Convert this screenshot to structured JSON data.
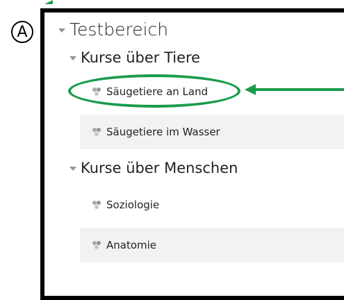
{
  "marker": {
    "label": "A"
  },
  "category": {
    "title": "Testbereich",
    "subcategories": [
      {
        "title": "Kurse über Tiere",
        "courses": [
          {
            "name": "Säugetiere an Land"
          },
          {
            "name": "Säugetiere im Wasser"
          }
        ]
      },
      {
        "title": "Kurse über Menschen",
        "courses": [
          {
            "name": "Soziologie"
          },
          {
            "name": "Anatomie"
          }
        ]
      }
    ]
  },
  "colors": {
    "accent": "#1a9b4b",
    "frame": "#000000",
    "row_alt": "#f2f2f2"
  },
  "icons": {
    "collapse": "triangle-down-icon",
    "course": "course-icon"
  }
}
